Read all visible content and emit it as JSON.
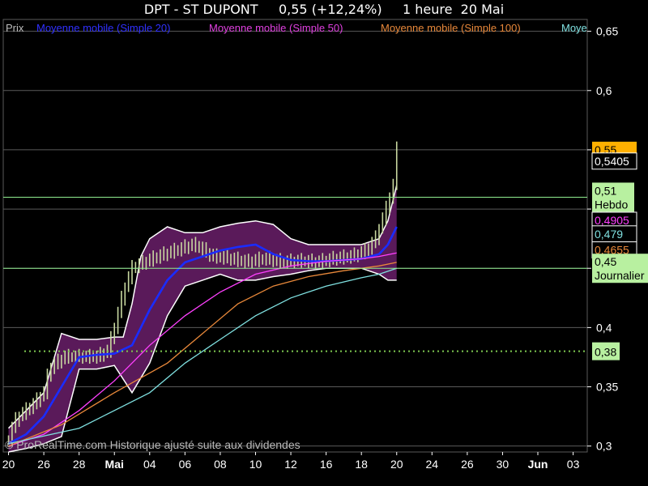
{
  "header": {
    "title": "DPT - ST DUPONT     0,55 (+12,24%)     1 heure  20 Mai"
  },
  "legend": {
    "items": [
      {
        "label": "Prix",
        "color": "#bdbdbd"
      },
      {
        "label": "Moyenne mobile (Simple 20)",
        "color": "#3030ff"
      },
      {
        "label": "Moyenne mobile (Simple 50)",
        "color": "#e040e0"
      },
      {
        "label": "Moyenne mobile (Simple 100)",
        "color": "#e8883a"
      },
      {
        "label": "Moye",
        "color": "#7fe0e0"
      }
    ]
  },
  "watermark": "© ProRealTime.com Historique ajusté suite aux dividendes",
  "colors": {
    "background": "#000000",
    "grid": "#5a5a5a",
    "candle": "#c8d8a0",
    "bollinger_fill": "#5a1a5a",
    "bollinger_edge": "#ffffff",
    "level_line": "#90ee90",
    "support_dotted": "#7ec850",
    "price_badge": "#ffb000"
  },
  "chart_data": {
    "type": "line",
    "title": "DPT - ST DUPONT     0,55 (+12,24%)     1 heure  20 Mai",
    "ylim": [
      0.295,
      0.66
    ],
    "y_ticks": [
      "0,65",
      "0,6",
      "0,55",
      "0,5",
      "0,45",
      "0,4",
      "0,35",
      "0,3"
    ],
    "y_tick_values": [
      0.65,
      0.6,
      0.55,
      0.5,
      0.45,
      0.4,
      0.35,
      0.3
    ],
    "x_ticks": [
      "20",
      "26",
      "28",
      "Mai",
      "04",
      "06",
      "08",
      "10",
      "12",
      "16",
      "18",
      "20",
      "24",
      "26",
      "30",
      "Jun",
      "03"
    ],
    "x_tick_index": [
      0,
      2,
      4,
      6,
      8,
      10,
      12,
      14,
      16,
      18,
      20,
      22,
      24,
      26,
      28,
      30,
      32
    ],
    "month_labels": [
      "Mai",
      "Jun"
    ],
    "x_range": [
      -0.3,
      32.8
    ],
    "grid": true,
    "price": [
      [
        0.0,
        0.305
      ],
      [
        0.3,
        0.32
      ],
      [
        0.6,
        0.325
      ],
      [
        1.0,
        0.33
      ],
      [
        1.4,
        0.335
      ],
      [
        2.0,
        0.345
      ],
      [
        2.3,
        0.365
      ],
      [
        2.7,
        0.37
      ],
      [
        3.2,
        0.375
      ],
      [
        4.0,
        0.375
      ],
      [
        5.0,
        0.375
      ],
      [
        5.6,
        0.38
      ],
      [
        6.0,
        0.4
      ],
      [
        6.5,
        0.43
      ],
      [
        7.0,
        0.45
      ],
      [
        7.7,
        0.455
      ],
      [
        8.5,
        0.46
      ],
      [
        9.5,
        0.465
      ],
      [
        10.5,
        0.47
      ],
      [
        11.5,
        0.46
      ],
      [
        12.5,
        0.458
      ],
      [
        13.5,
        0.455
      ],
      [
        14.5,
        0.458
      ],
      [
        15.5,
        0.455
      ],
      [
        16.5,
        0.456
      ],
      [
        17.5,
        0.455
      ],
      [
        18.5,
        0.458
      ],
      [
        19.5,
        0.46
      ],
      [
        20.3,
        0.465
      ],
      [
        20.8,
        0.475
      ],
      [
        21.4,
        0.5
      ],
      [
        21.8,
        0.52
      ],
      [
        22.0,
        0.55
      ]
    ],
    "series": [
      {
        "name": "Moyenne mobile (Simple 20)",
        "color": "#1a2cff",
        "points": [
          [
            0.0,
            0.302
          ],
          [
            1.0,
            0.31
          ],
          [
            2.0,
            0.325
          ],
          [
            3.0,
            0.35
          ],
          [
            4.0,
            0.375
          ],
          [
            5.0,
            0.377
          ],
          [
            6.0,
            0.378
          ],
          [
            7.0,
            0.385
          ],
          [
            8.0,
            0.415
          ],
          [
            9.0,
            0.44
          ],
          [
            10.0,
            0.455
          ],
          [
            11.0,
            0.46
          ],
          [
            12.0,
            0.465
          ],
          [
            13.0,
            0.468
          ],
          [
            14.0,
            0.47
          ],
          [
            15.0,
            0.462
          ],
          [
            16.0,
            0.457
          ],
          [
            17.0,
            0.456
          ],
          [
            18.0,
            0.456
          ],
          [
            19.0,
            0.457
          ],
          [
            20.0,
            0.458
          ],
          [
            21.0,
            0.462
          ],
          [
            21.5,
            0.47
          ],
          [
            22.0,
            0.485
          ]
        ]
      },
      {
        "name": "Moyenne mobile (Simple 50)",
        "color": "#ff40ff",
        "points": [
          [
            0.0,
            0.3
          ],
          [
            2.0,
            0.31
          ],
          [
            4.0,
            0.33
          ],
          [
            6.0,
            0.355
          ],
          [
            8.0,
            0.385
          ],
          [
            10.0,
            0.41
          ],
          [
            12.0,
            0.43
          ],
          [
            14.0,
            0.445
          ],
          [
            16.0,
            0.452
          ],
          [
            18.0,
            0.456
          ],
          [
            20.0,
            0.458
          ],
          [
            21.0,
            0.46
          ],
          [
            22.0,
            0.463
          ]
        ]
      },
      {
        "name": "Moyenne mobile (Simple 100)",
        "color": "#e8883a",
        "points": [
          [
            0.0,
            0.3
          ],
          [
            3.0,
            0.318
          ],
          [
            6.0,
            0.345
          ],
          [
            9.0,
            0.37
          ],
          [
            11.0,
            0.395
          ],
          [
            13.0,
            0.42
          ],
          [
            15.0,
            0.435
          ],
          [
            17.0,
            0.443
          ],
          [
            19.0,
            0.448
          ],
          [
            21.0,
            0.452
          ],
          [
            22.0,
            0.455
          ]
        ]
      },
      {
        "name": "Moye",
        "color": "#7fe0e0",
        "points": [
          [
            0.0,
            0.302
          ],
          [
            4.0,
            0.315
          ],
          [
            6.0,
            0.33
          ],
          [
            8.0,
            0.345
          ],
          [
            10.0,
            0.37
          ],
          [
            12.0,
            0.39
          ],
          [
            14.0,
            0.41
          ],
          [
            16.0,
            0.425
          ],
          [
            18.0,
            0.435
          ],
          [
            20.0,
            0.442
          ],
          [
            21.0,
            0.445
          ],
          [
            22.0,
            0.45
          ]
        ]
      }
    ],
    "bollinger_upper": [
      [
        0.0,
        0.315
      ],
      [
        1.0,
        0.33
      ],
      [
        2.0,
        0.345
      ],
      [
        3.0,
        0.395
      ],
      [
        4.0,
        0.39
      ],
      [
        5.0,
        0.39
      ],
      [
        6.0,
        0.392
      ],
      [
        6.5,
        0.392
      ],
      [
        7.0,
        0.42
      ],
      [
        7.5,
        0.46
      ],
      [
        8.0,
        0.475
      ],
      [
        9.0,
        0.485
      ],
      [
        10.0,
        0.48
      ],
      [
        11.0,
        0.48
      ],
      [
        12.0,
        0.485
      ],
      [
        13.0,
        0.488
      ],
      [
        14.0,
        0.49
      ],
      [
        15.0,
        0.487
      ],
      [
        16.0,
        0.475
      ],
      [
        17.0,
        0.47
      ],
      [
        18.0,
        0.47
      ],
      [
        19.0,
        0.47
      ],
      [
        20.0,
        0.47
      ],
      [
        21.0,
        0.475
      ],
      [
        21.5,
        0.49
      ],
      [
        22.0,
        0.52
      ]
    ],
    "bollinger_lower": [
      [
        0.0,
        0.295
      ],
      [
        1.0,
        0.298
      ],
      [
        2.0,
        0.302
      ],
      [
        3.0,
        0.308
      ],
      [
        4.0,
        0.365
      ],
      [
        5.0,
        0.365
      ],
      [
        6.0,
        0.368
      ],
      [
        7.0,
        0.345
      ],
      [
        8.0,
        0.37
      ],
      [
        9.0,
        0.41
      ],
      [
        10.0,
        0.435
      ],
      [
        11.0,
        0.44
      ],
      [
        12.0,
        0.445
      ],
      [
        13.0,
        0.44
      ],
      [
        14.0,
        0.44
      ],
      [
        15.0,
        0.443
      ],
      [
        16.0,
        0.445
      ],
      [
        17.0,
        0.448
      ],
      [
        18.0,
        0.45
      ],
      [
        19.0,
        0.45
      ],
      [
        20.0,
        0.45
      ],
      [
        21.0,
        0.445
      ],
      [
        21.5,
        0.44
      ],
      [
        22.0,
        0.44
      ]
    ],
    "horizontal_levels": [
      {
        "value": 0.51,
        "label_top": "0,51",
        "label_bottom": "Hebdo",
        "style": "solid"
      },
      {
        "value": 0.45,
        "label_top": "0,45",
        "label_bottom": "Journalier",
        "style": "solid"
      },
      {
        "value": 0.38,
        "label_top": "0,38",
        "label_bottom": "",
        "style": "dotted"
      }
    ],
    "right_badges": [
      {
        "value": 0.55,
        "label": "0,55",
        "color": "#ffb000",
        "text": "#000000"
      },
      {
        "value": 0.5405,
        "label": "0,5405",
        "color": "#000000",
        "text": "#ffffff",
        "border": "#ffffff"
      },
      {
        "value": 0.4905,
        "label": "0,4905",
        "color": "#000000",
        "text": "#ff40ff",
        "border": "#ffffff"
      },
      {
        "value": 0.479,
        "label": "0,479",
        "color": "#000000",
        "text": "#7fe0e0",
        "border": "#ffffff"
      },
      {
        "value": 0.4655,
        "label": "0,4655",
        "color": "#000000",
        "text": "#e8883a",
        "border": "#ffffff"
      }
    ]
  }
}
